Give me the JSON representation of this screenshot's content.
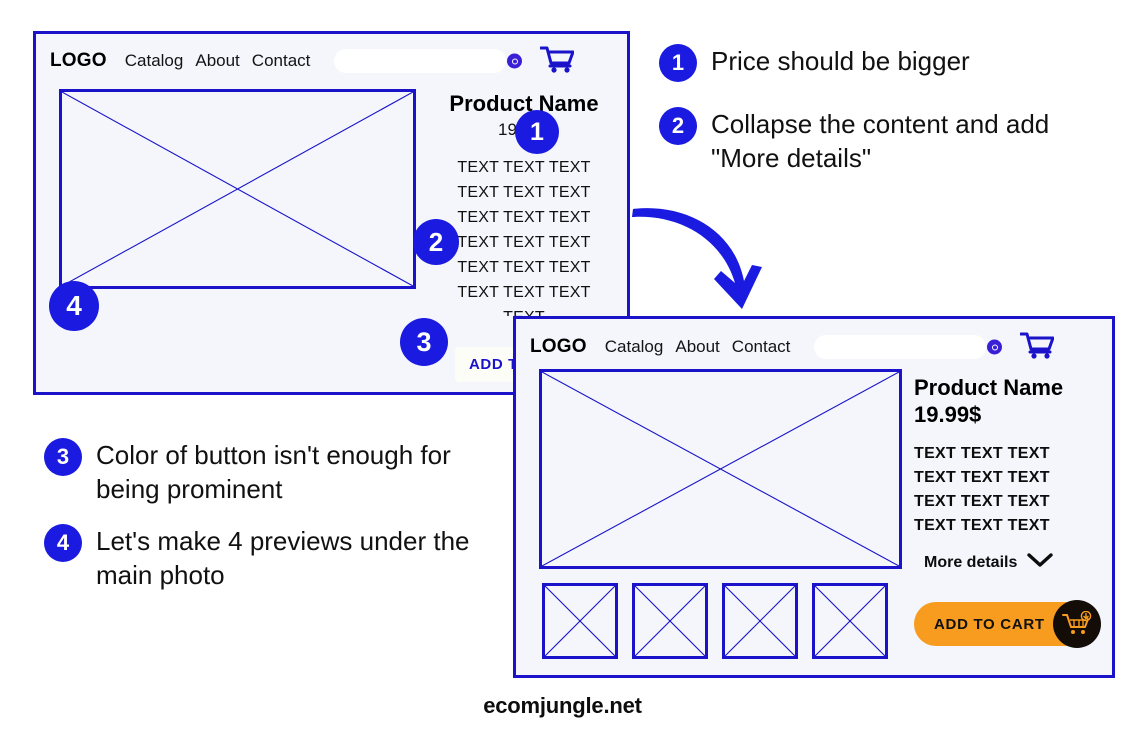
{
  "meta": {
    "footer_text": "ecomjungle.net",
    "colors": {
      "wire_blue": "#1a13c9",
      "badge_blue": "#1a1ae0",
      "card_bg": "#f4f6fc",
      "cta_orange": "#f79c1e",
      "cta_circle": "#130c07",
      "page_bg": "#ffffff"
    }
  },
  "card_before": {
    "header": {
      "logo": "LOGO",
      "nav": [
        "Catalog",
        "About",
        "Contact"
      ],
      "search_placeholder": "",
      "search_value": "",
      "search_icon": "search-icon",
      "cart_icon": "shopping-cart-icon"
    },
    "main_image_alt": "image-placeholder",
    "product": {
      "title": "Product Name",
      "price": "19.99$",
      "description_lines": [
        "TEXT TEXT TEXT",
        "TEXT TEXT TEXT",
        "TEXT TEXT TEXT",
        "TEXT TEXT TEXT",
        "TEXT TEXT TEXT",
        "TEXT TEXT TEXT",
        "TEXT"
      ]
    },
    "cta_label": "ADD TO CART"
  },
  "card_after": {
    "header": {
      "logo": "LOGO",
      "nav": [
        "Catalog",
        "About",
        "Contact"
      ],
      "search_placeholder": "",
      "search_value": "",
      "search_icon": "search-icon",
      "cart_icon": "shopping-cart-icon"
    },
    "main_image_alt": "image-placeholder",
    "product": {
      "title": "Product Name",
      "price": "19.99$",
      "description_lines": [
        "TEXT TEXT TEXT",
        "TEXT TEXT TEXT",
        "TEXT TEXT TEXT",
        "TEXT TEXT TEXT"
      ],
      "more_details_label": "More details",
      "more_details_icon": "chevron-down-icon"
    },
    "thumbnails": [
      "preview-1",
      "preview-2",
      "preview-3",
      "preview-4"
    ],
    "cta_label": "ADD TO CART",
    "cta_icon": "add-to-cart-icon"
  },
  "annotations": [
    {
      "number": "1",
      "text": "Price should be bigger"
    },
    {
      "number": "2",
      "text": "Collapse the content and add \"More details\""
    },
    {
      "number": "3",
      "text": "Color of button isn't enough for being prominent"
    },
    {
      "number": "4",
      "text": "Let's make 4 previews under the main photo"
    }
  ],
  "markers": {
    "m1": "1",
    "m2": "2",
    "m3": "3",
    "m4": "4"
  }
}
